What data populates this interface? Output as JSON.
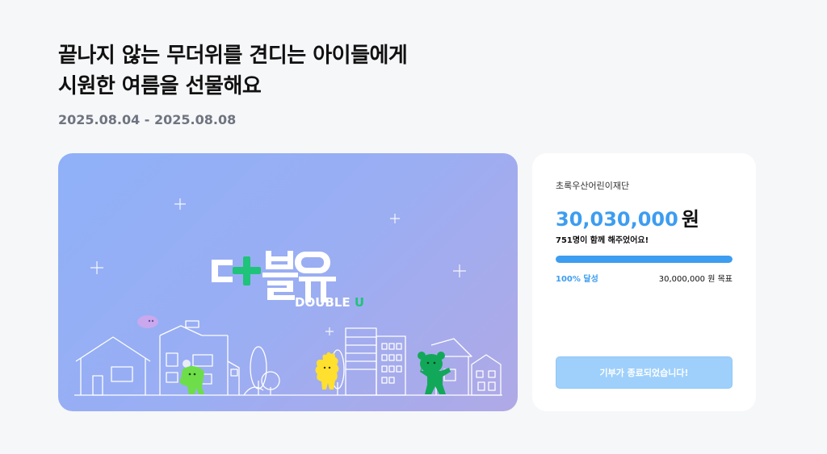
{
  "campaign": {
    "title_lines": [
      "끝나지 않는 무더위를 견디는 아이들에게",
      "시원한 여름을 선물해요"
    ],
    "period": "2025.08.04 - 2025.08.08"
  },
  "banner": {
    "logo_text": "DOUBLE U",
    "logo_accent": "U",
    "colors": {
      "accent_green": "#1fc37a",
      "accent_yellow": "#ffe02e",
      "logo_white": "#ffffff"
    }
  },
  "donation": {
    "organization": "초록우산어린이재단",
    "amount": "30,030,000",
    "amount_unit": "원",
    "donors_text": "751명이 함께 해주었어요!",
    "progress_fraction": 1.0,
    "achieved_label": "100% 달성",
    "goal_label": "30,000,000 원 목표",
    "button_label": "기부가 종료되었습니다!",
    "colors": {
      "accent": "#3d9df0",
      "button_disabled": "#9fd0fb"
    }
  }
}
